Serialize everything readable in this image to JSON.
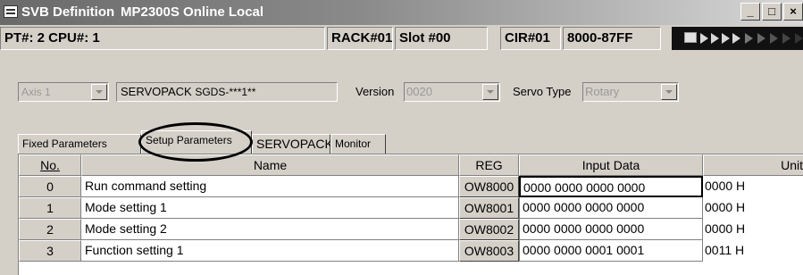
{
  "window": {
    "title": "SVB Definition",
    "subtitle": "MP2300S  Online Local",
    "buttons": [
      "_",
      "□",
      "×"
    ]
  },
  "infobar": {
    "pt_cpu": "PT#: 2 CPU#: 1",
    "rack": "RACK#01",
    "slot": "Slot #00",
    "cir": "CIR#01",
    "range": "8000-87FF"
  },
  "axis": {
    "selected": "Axis 1",
    "servopack_label": "SERVOPACK",
    "servopack_model": "SGDS-***1**",
    "version_label": "Version",
    "version_value": "0020",
    "servo_type_label": "Servo Type",
    "servo_type_value": "Rotary"
  },
  "tabs": [
    {
      "label": "Fixed Parameters",
      "active": false
    },
    {
      "label": "Setup Parameters",
      "active": true
    },
    {
      "label": "SERVOPACK",
      "active": false
    },
    {
      "label": "Monitor",
      "active": false
    }
  ],
  "table": {
    "headers": [
      "No.",
      "Name",
      "REG",
      "Input Data",
      "Unit"
    ],
    "rows": [
      {
        "no": "0",
        "name": "Run command setting",
        "reg": "OW8000",
        "input": "0000 0000 0000 0000",
        "unit": "0000 H"
      },
      {
        "no": "1",
        "name": "Mode setting 1",
        "reg": "OW8001",
        "input": "0000 0000 0000 0000",
        "unit": "0000 H"
      },
      {
        "no": "2",
        "name": "Mode setting 2",
        "reg": "OW8002",
        "input": "0000 0000 0000 0000",
        "unit": "0000 H"
      },
      {
        "no": "3",
        "name": "Function setting 1",
        "reg": "OW8003",
        "input": "0000 0000 0001 0001",
        "unit": "0011 H"
      }
    ]
  }
}
